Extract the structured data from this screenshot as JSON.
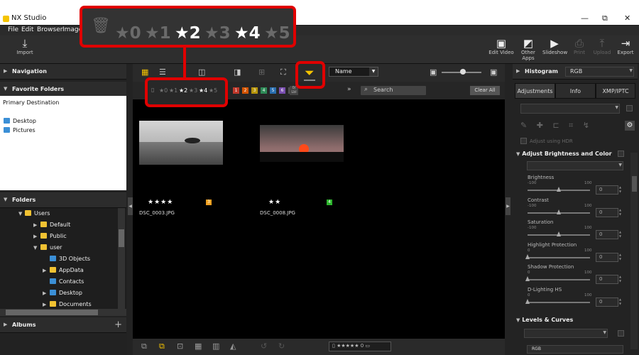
{
  "window": {
    "title": "NX Studio",
    "min": "—",
    "max": "⧉",
    "close": "✕"
  },
  "menu": [
    "File",
    "Edit",
    "Browser",
    "Image"
  ],
  "toolbar": {
    "import": "Import",
    "edit_video": "Edit Video",
    "other_apps": "Other Apps",
    "slideshow": "Slideshow",
    "print": "Print",
    "upload": "Upload",
    "export": "Export"
  },
  "left": {
    "navigation": "Navigation",
    "favorite_folders": "Favorite Folders",
    "primary_destination": "Primary Destination",
    "desktop": "Desktop",
    "pictures": "Pictures",
    "folders": "Folders",
    "albums": "Albums",
    "albums_add": "+",
    "tree": [
      {
        "label": "Users",
        "depth": 0,
        "expanded": true
      },
      {
        "label": "Default",
        "depth": 1,
        "expanded": false
      },
      {
        "label": "Public",
        "depth": 1,
        "expanded": false
      },
      {
        "label": "user",
        "depth": 1,
        "expanded": true
      },
      {
        "label": "3D Objects",
        "depth": 2,
        "expanded": null
      },
      {
        "label": "AppData",
        "depth": 2,
        "expanded": false
      },
      {
        "label": "Contacts",
        "depth": 2,
        "expanded": null
      },
      {
        "label": "Desktop",
        "depth": 2,
        "expanded": false
      },
      {
        "label": "Documents",
        "depth": 2,
        "expanded": false
      }
    ]
  },
  "center": {
    "sort_value": "Name",
    "search_placeholder": "Search",
    "clear_all": "Clear All",
    "more": "»",
    "labels": [
      {
        "num": "1",
        "color": "#c0392b"
      },
      {
        "num": "2",
        "color": "#d35400"
      },
      {
        "num": "3",
        "color": "#b7950b"
      },
      {
        "num": "4",
        "color": "#2e8b57"
      },
      {
        "num": "5",
        "color": "#2a6fb0"
      },
      {
        "num": "6",
        "color": "#7a4fb0"
      },
      {
        "num": "7",
        "color": "#555555"
      }
    ],
    "label_reset": "0/ Lbl",
    "images": [
      {
        "rating": "★★★★",
        "file": "DSC_0003.JPG",
        "label": "3",
        "label_color": "#f0a020"
      },
      {
        "rating": "★★",
        "file": "DSC_0008.JPG",
        "label": "4",
        "label_color": "#2db52d"
      }
    ]
  },
  "rating_filter": {
    "items": [
      {
        "text": "★0",
        "active": false
      },
      {
        "text": "★1",
        "active": false
      },
      {
        "text": "★2",
        "active": true
      },
      {
        "text": "★3",
        "active": false
      },
      {
        "text": "★4",
        "active": true
      },
      {
        "text": "★5",
        "active": false
      }
    ]
  },
  "bottom": {
    "stars": "★★★★★",
    "badges": "0 ▭"
  },
  "right": {
    "histogram": "Histogram",
    "histogram_mode": "RGB",
    "tabs": [
      "Adjustments",
      "Info",
      "XMP/IPTC"
    ],
    "adjust_hdr": "Adjust using HDR",
    "section_bc": "Adjust Brightness and Color",
    "sliders": [
      {
        "label": "Brightness",
        "min": "-100",
        "max": "100",
        "value": "0",
        "pos": 0.5
      },
      {
        "label": "Contrast",
        "min": "-100",
        "max": "100",
        "value": "0",
        "pos": 0.5
      },
      {
        "label": "Saturation",
        "min": "-100",
        "max": "100",
        "value": "0",
        "pos": 0.5
      },
      {
        "label": "Highlight Protection",
        "min": "0",
        "max": "100",
        "value": "0",
        "pos": 0.0
      },
      {
        "label": "Shadow Protection",
        "min": "0",
        "max": "100",
        "value": "0",
        "pos": 0.0
      },
      {
        "label": "D-Lighting HS",
        "min": "0",
        "max": "100",
        "value": "0",
        "pos": 0.0
      }
    ],
    "section_lc": "Levels & Curves",
    "lc_mode": "RGB"
  }
}
